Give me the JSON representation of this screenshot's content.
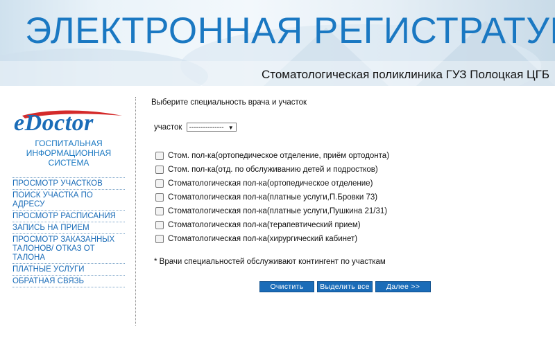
{
  "header": {
    "title": "ЭЛЕКТРОННАЯ РЕГИСТРАТУРА",
    "subtitle": "Стоматологическая поликлиника ГУЗ Полоцкая ЦГБ"
  },
  "sidebar": {
    "logo_text_e": "e",
    "logo_text_rest": "Doctor",
    "logo_caption": "ГОСПИТАЛЬНАЯ ИНФОРМАЦИОННАЯ СИСТЕМА",
    "menu": [
      {
        "label": "ПРОСМОТР УЧАСТКОВ"
      },
      {
        "label": "ПОИСК УЧАСТКА ПО АДРЕСУ"
      },
      {
        "label": "ПРОСМОТР РАСПИСАНИЯ"
      },
      {
        "label": "ЗАПИСЬ НА ПРИЕМ"
      },
      {
        "label": "ПРОСМОТР ЗАКАЗАННЫХ ТАЛОНОВ/ ОТКАЗ ОТ ТАЛОНА"
      },
      {
        "label": "ПЛАТНЫЕ УСЛУГИ"
      },
      {
        "label": "ОБРАТНАЯ СВЯЗЬ"
      }
    ]
  },
  "main": {
    "instruction": "Выберите специальность врача и участок",
    "district_label": "участок",
    "district_selected": "---------------",
    "specialties": [
      {
        "label": "Стом. пол-ка(ортопедическое отделение, приём ортодонта)",
        "checked": false
      },
      {
        "label": "Стом. пол-ка(отд. по обслуживанию детей и подростков)",
        "checked": false
      },
      {
        "label": "Стоматологическая пол-ка(ортопедическое отделение)",
        "checked": false
      },
      {
        "label": "Стоматологическая пол-ка(платные услуги,П.Бровки 73)",
        "checked": false
      },
      {
        "label": "Стоматологическая пол-ка(платные услуги,Пушкина 21/31)",
        "checked": false
      },
      {
        "label": "Стоматологическая пол-ка(терапевтический прием)",
        "checked": false
      },
      {
        "label": "Стоматологическая пол-ка(хирургический кабинет)",
        "checked": false
      }
    ],
    "note": "* Врачи специальностей обслуживают контингент по участкам",
    "buttons": {
      "clear": "Очистить",
      "select_all": "Выделить все",
      "next": "Далее >>"
    }
  },
  "colors": {
    "brand_blue": "#1a78c2",
    "button_blue": "#1a6cb8",
    "logo_red": "#d42a2a"
  }
}
